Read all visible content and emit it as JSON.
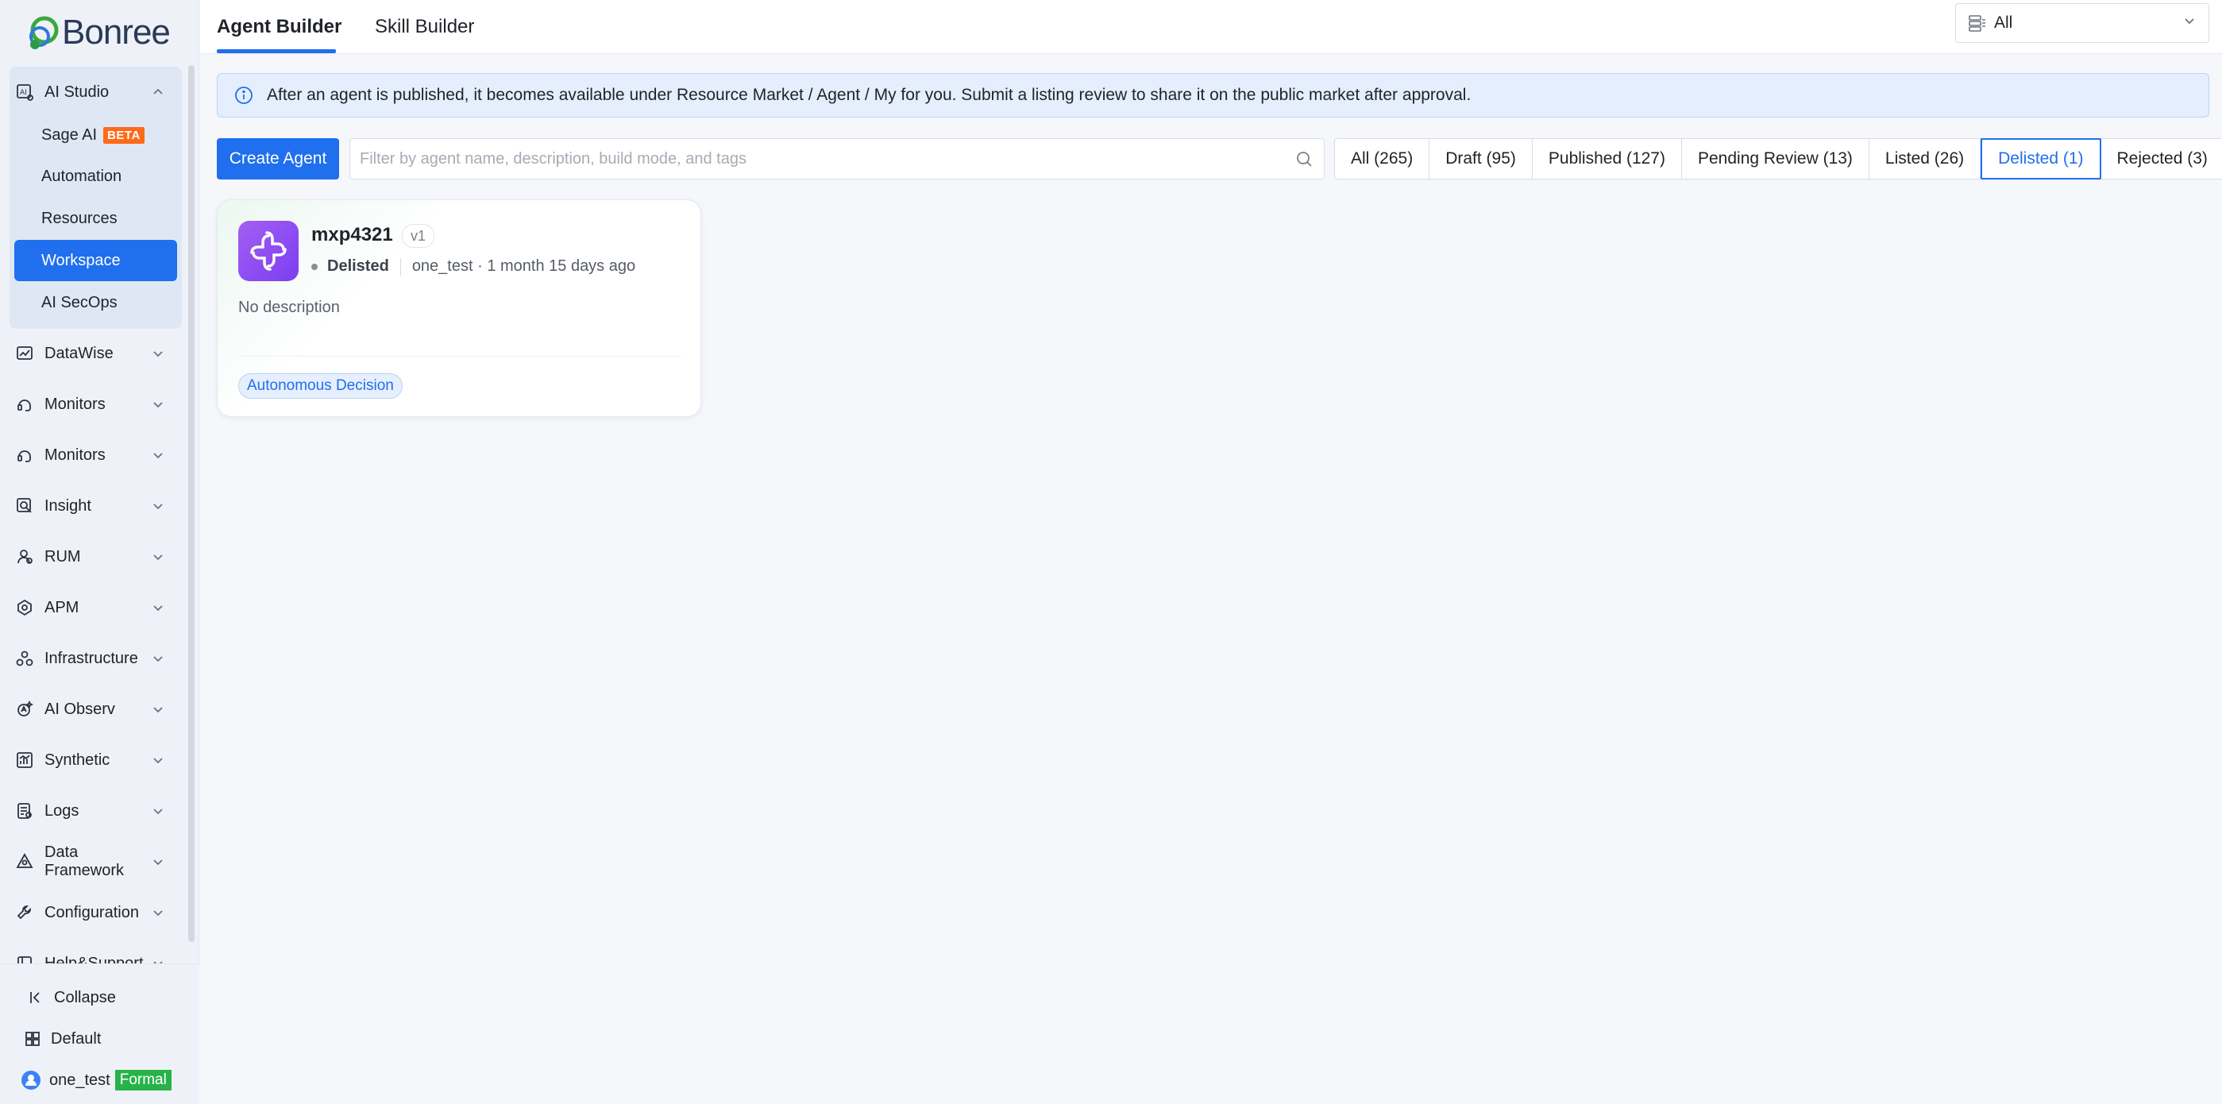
{
  "brand": {
    "name": "Bonree"
  },
  "sidebar": {
    "studio": {
      "label": "AI Studio",
      "items": [
        {
          "label": "Sage AI",
          "badge": "BETA"
        },
        {
          "label": "Automation"
        },
        {
          "label": "Resources"
        },
        {
          "label": "Workspace",
          "active": true
        },
        {
          "label": "AI SecOps"
        }
      ]
    },
    "groups": [
      {
        "label": "DataWise",
        "icon": "chart-icon"
      },
      {
        "label": "Monitors",
        "icon": "headset-icon"
      },
      {
        "label": "Monitors",
        "icon": "headset-icon"
      },
      {
        "label": "Insight",
        "icon": "insight-icon"
      },
      {
        "label": "RUM",
        "icon": "user-icon"
      },
      {
        "label": "APM",
        "icon": "apm-icon"
      },
      {
        "label": "Infrastructure",
        "icon": "infrastructure-icon"
      },
      {
        "label": "AI Observ",
        "icon": "ai-observ-icon"
      },
      {
        "label": "Synthetic",
        "icon": "synthetic-icon"
      },
      {
        "label": "Logs",
        "icon": "logs-icon"
      },
      {
        "label": "Data Framework",
        "icon": "data-framework-icon"
      },
      {
        "label": "Configuration",
        "icon": "wrench-icon"
      },
      {
        "label": "Help&Support",
        "icon": "book-icon"
      }
    ],
    "footer": {
      "collapse": "Collapse",
      "default": "Default",
      "user": "one_test",
      "env_badge": "Formal"
    }
  },
  "topbar": {
    "tabs": [
      {
        "label": "Agent Builder",
        "active": true
      },
      {
        "label": "Skill Builder"
      }
    ],
    "scope_select": {
      "value": "All"
    }
  },
  "banner": {
    "text": "After an agent is published, it becomes available under Resource Market / Agent / My for you. Submit a listing review to share it on the public market after approval."
  },
  "toolbar": {
    "create_label": "Create Agent",
    "search_placeholder": "Filter by agent name, description, build mode, and tags",
    "filters": [
      {
        "label": "All (265)"
      },
      {
        "label": "Draft (95)"
      },
      {
        "label": "Published (127)"
      },
      {
        "label": "Pending Review (13)"
      },
      {
        "label": "Listed (26)"
      },
      {
        "label": "Delisted (1)",
        "active": true
      },
      {
        "label": "Rejected (3)"
      }
    ]
  },
  "cards": [
    {
      "name": "mxp4321",
      "version": "v1",
      "status": "Delisted",
      "owner_time": "one_test · 1 month 15 days ago",
      "description": "No description",
      "tag": "Autonomous Decision"
    }
  ],
  "colors": {
    "primary": "#1f6fee",
    "beta_badge": "#ff6a1a",
    "formal_badge": "#27b34a",
    "avatar": "#8b4cf2"
  }
}
